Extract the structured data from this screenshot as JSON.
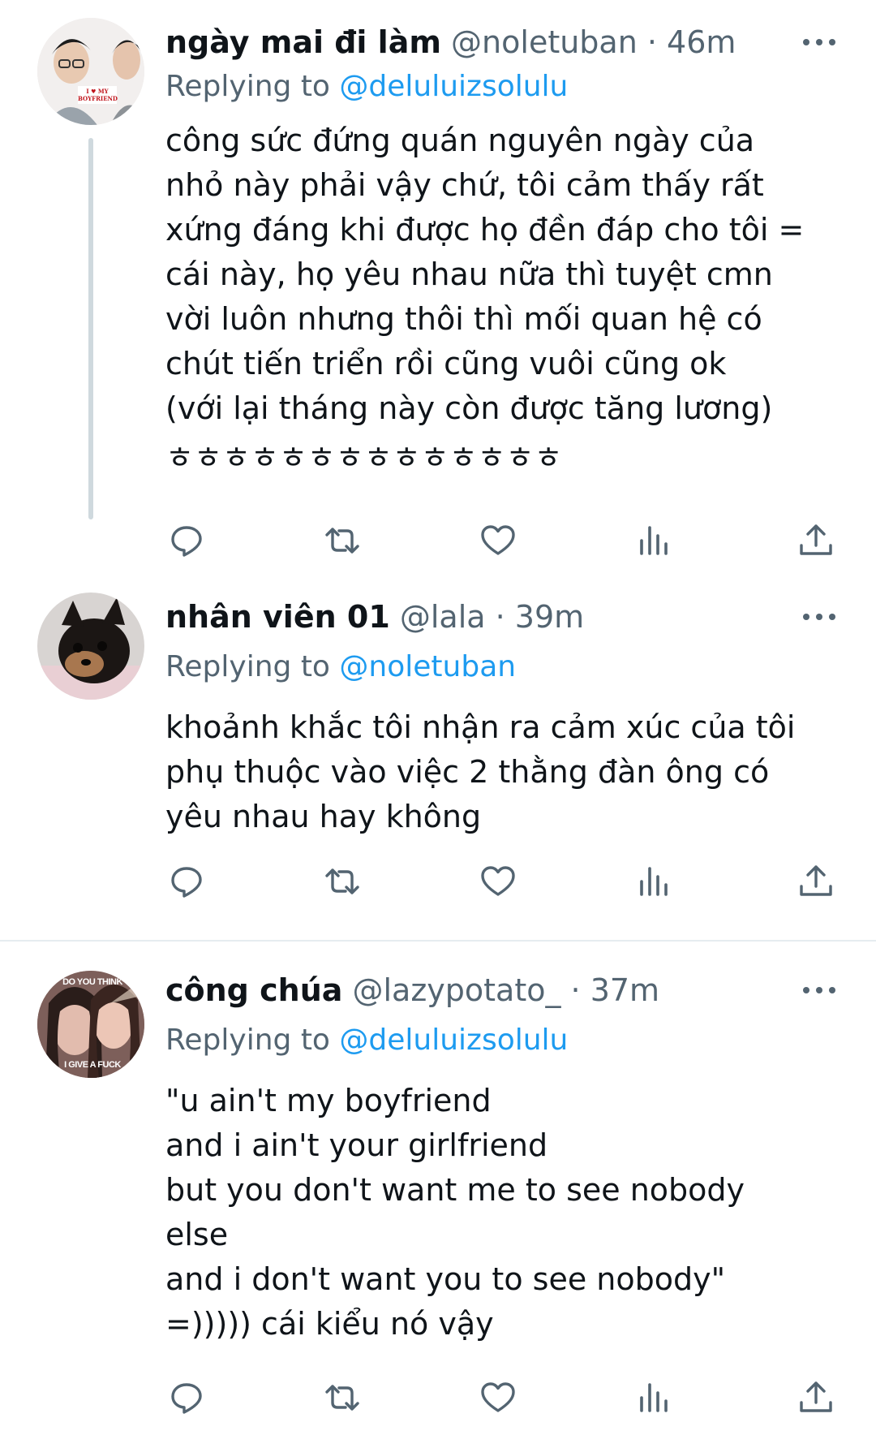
{
  "tweets": [
    {
      "display_name": "ngày mai đi làm",
      "handle_time": "@noletuban · 46m",
      "replying_prefix": "Replying to",
      "replying_to": "@deluluizsolulu",
      "avatar_text": "I ♥ MY BOYFRIEND",
      "lines": [
        "công sức đứng quán nguyên ngày của",
        "nhỏ này phải vậy chứ, tôi cảm thấy rất",
        "xứng đáng khi được họ đền đáp cho tôi =",
        "cái này, họ yêu nhau nữa thì tuyệt cmn",
        "vời luôn nhưng thôi thì mối quan hệ có",
        "chút tiến triển rồi cũng vuôi cũng ok",
        "(với lại tháng này còn được tăng lương)",
        "ㅎㅎㅎㅎㅎㅎㅎㅎㅎㅎㅎㅎㅎㅎ"
      ]
    },
    {
      "display_name": "nhân viên 01",
      "handle_time": "@lala · 39m",
      "replying_prefix": "Replying to",
      "replying_to": "@noletuban",
      "lines": [
        "khoảnh khắc tôi nhận ra cảm xúc của tôi",
        "phụ thuộc vào việc 2 thằng đàn ông có",
        "yêu nhau hay không"
      ]
    },
    {
      "display_name": "công chúa",
      "handle_time": "@lazypotato_ · 37m",
      "replying_prefix": "Replying to",
      "replying_to": "@deluluizsolulu",
      "avatar_text_top": "DO YOU THINK",
      "avatar_text_bottom": "I GIVE A FUCK",
      "lines": [
        "\"u ain't my boyfriend",
        "and i ain't your girlfriend",
        "but you don't want me to see nobody",
        "else",
        "and i don't want you to see nobody\"",
        "=))))) cái kiểu nó vậy"
      ]
    }
  ],
  "icons": [
    "reply-icon",
    "retweet-icon",
    "like-icon",
    "views-icon",
    "share-icon",
    "more-icon"
  ],
  "colors": {
    "text": "#0f1419",
    "secondary": "#536471",
    "link": "#1d9bf0",
    "thread_line": "#cfd9de",
    "divider": "#e6ecf0"
  }
}
